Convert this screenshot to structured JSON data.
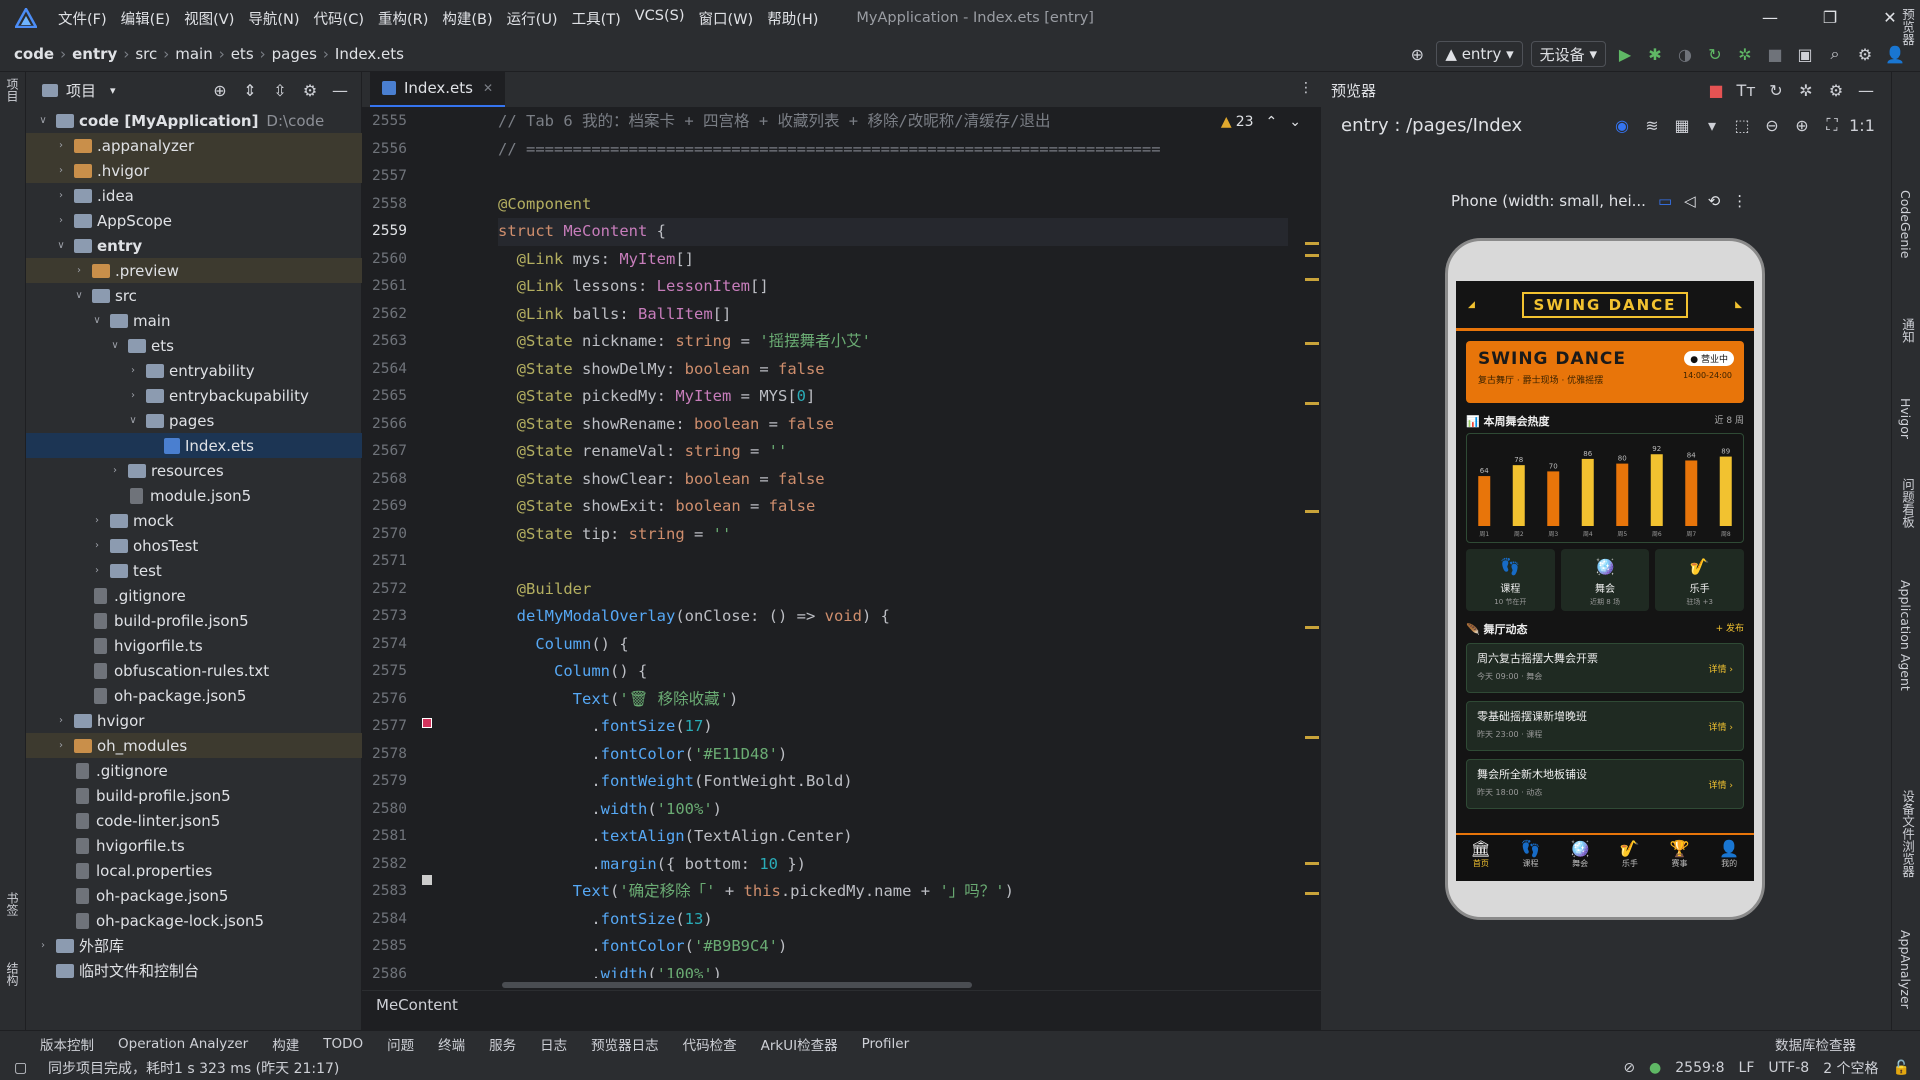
{
  "titlebar": {
    "menus": [
      "文件(F)",
      "编辑(E)",
      "视图(V)",
      "导航(N)",
      "代码(C)",
      "重构(R)",
      "构建(B)",
      "运行(U)",
      "工具(T)",
      "VCS(S)",
      "窗口(W)",
      "帮助(H)"
    ],
    "window_title": "MyApplication - Index.ets [entry]"
  },
  "toolbar": {
    "breadcrumbs": [
      "code",
      "entry",
      "src",
      "main",
      "ets",
      "pages",
      "Index.ets"
    ],
    "run_config": "entry",
    "device": "无设备"
  },
  "leftstrip": {
    "project_label": "项目",
    "bookmarks_label": "书签",
    "structure_label": "结构"
  },
  "project": {
    "title": "项目",
    "tree": [
      {
        "depth": 0,
        "chev": "v",
        "icon": "folder",
        "label": "code [MyApplication]",
        "path": "D:\\code",
        "bold": true
      },
      {
        "depth": 1,
        "chev": ">",
        "icon": "ofolder",
        "label": ".appanalyzer",
        "hl": true
      },
      {
        "depth": 1,
        "chev": ">",
        "icon": "ofolder",
        "label": ".hvigor",
        "hl": true
      },
      {
        "depth": 1,
        "chev": ">",
        "icon": "folder",
        "label": ".idea"
      },
      {
        "depth": 1,
        "chev": ">",
        "icon": "folder",
        "label": "AppScope"
      },
      {
        "depth": 1,
        "chev": "v",
        "icon": "folder",
        "label": "entry",
        "bold": true
      },
      {
        "depth": 2,
        "chev": ">",
        "icon": "ofolder",
        "label": ".preview",
        "hl": true
      },
      {
        "depth": 2,
        "chev": "v",
        "icon": "folder",
        "label": "src"
      },
      {
        "depth": 3,
        "chev": "v",
        "icon": "folder",
        "label": "main"
      },
      {
        "depth": 4,
        "chev": "v",
        "icon": "folder",
        "label": "ets"
      },
      {
        "depth": 5,
        "chev": ">",
        "icon": "folder",
        "label": "entryability"
      },
      {
        "depth": 5,
        "chev": ">",
        "icon": "folder",
        "label": "entrybackupability"
      },
      {
        "depth": 5,
        "chev": "v",
        "icon": "folder",
        "label": "pages"
      },
      {
        "depth": 6,
        "chev": "",
        "icon": "ets",
        "label": "Index.ets",
        "sel": true
      },
      {
        "depth": 4,
        "chev": ">",
        "icon": "folder",
        "label": "resources"
      },
      {
        "depth": 4,
        "chev": "",
        "icon": "file",
        "label": "module.json5"
      },
      {
        "depth": 3,
        "chev": ">",
        "icon": "folder",
        "label": "mock"
      },
      {
        "depth": 3,
        "chev": ">",
        "icon": "folder",
        "label": "ohosTest"
      },
      {
        "depth": 3,
        "chev": ">",
        "icon": "folder",
        "label": "test"
      },
      {
        "depth": 2,
        "chev": "",
        "icon": "file",
        "label": ".gitignore"
      },
      {
        "depth": 2,
        "chev": "",
        "icon": "file",
        "label": "build-profile.json5"
      },
      {
        "depth": 2,
        "chev": "",
        "icon": "file",
        "label": "hvigorfile.ts"
      },
      {
        "depth": 2,
        "chev": "",
        "icon": "file",
        "label": "obfuscation-rules.txt"
      },
      {
        "depth": 2,
        "chev": "",
        "icon": "file",
        "label": "oh-package.json5"
      },
      {
        "depth": 1,
        "chev": ">",
        "icon": "folder",
        "label": "hvigor"
      },
      {
        "depth": 1,
        "chev": ">",
        "icon": "ofolder",
        "label": "oh_modules",
        "hl": true
      },
      {
        "depth": 1,
        "chev": "",
        "icon": "file",
        "label": ".gitignore"
      },
      {
        "depth": 1,
        "chev": "",
        "icon": "file",
        "label": "build-profile.json5"
      },
      {
        "depth": 1,
        "chev": "",
        "icon": "file",
        "label": "code-linter.json5"
      },
      {
        "depth": 1,
        "chev": "",
        "icon": "file",
        "label": "hvigorfile.ts"
      },
      {
        "depth": 1,
        "chev": "",
        "icon": "file",
        "label": "local.properties"
      },
      {
        "depth": 1,
        "chev": "",
        "icon": "file",
        "label": "oh-package.json5"
      },
      {
        "depth": 1,
        "chev": "",
        "icon": "file",
        "label": "oh-package-lock.json5"
      },
      {
        "depth": 0,
        "chev": ">",
        "icon": "folder",
        "label": "外部库"
      },
      {
        "depth": 0,
        "chev": "",
        "icon": "folder",
        "label": "临时文件和控制台"
      }
    ]
  },
  "editor": {
    "tab": "Index.ets",
    "warning_count": "23",
    "current_line": "2559",
    "breadcrumb_footer": "MeContent",
    "lines": [
      {
        "n": "2555",
        "html": "<span class=\"cmt\">// Tab 6 我的：档案卡 + 四宫格 + 收藏列表 + 移除/改昵称/清缓存/退出</span>"
      },
      {
        "n": "2556",
        "html": "<span class=\"cmt\">// ====================================================================</span>"
      },
      {
        "n": "2557",
        "html": ""
      },
      {
        "n": "2558",
        "html": "<span class=\"ann\">@Component</span>"
      },
      {
        "n": "2559",
        "html": "<span class=\"kw\">struct</span> <span class=\"typ\">MeContent</span> {"
      },
      {
        "n": "2560",
        "html": "  <span class=\"ann\">@Link</span> mys: <span class=\"typ\">MyItem</span>[]"
      },
      {
        "n": "2561",
        "html": "  <span class=\"ann\">@Link</span> lessons: <span class=\"typ\">LessonItem</span>[]"
      },
      {
        "n": "2562",
        "html": "  <span class=\"ann\">@Link</span> balls: <span class=\"typ\">BallItem</span>[]"
      },
      {
        "n": "2563",
        "html": "  <span class=\"ann\">@State</span> nickname: <span class=\"kw\">string</span> = <span class=\"str\">'摇摆舞者小艾'</span>"
      },
      {
        "n": "2564",
        "html": "  <span class=\"ann\">@State</span> showDelMy: <span class=\"kw\">boolean</span> = <span class=\"kw\">false</span>"
      },
      {
        "n": "2565",
        "html": "  <span class=\"ann\">@State</span> pickedMy: <span class=\"typ\">MyItem</span> = MYS[<span class=\"num\">0</span>]"
      },
      {
        "n": "2566",
        "html": "  <span class=\"ann\">@State</span> showRename: <span class=\"kw\">boolean</span> = <span class=\"kw\">false</span>"
      },
      {
        "n": "2567",
        "html": "  <span class=\"ann\">@State</span> renameVal: <span class=\"kw\">string</span> = <span class=\"str\">''</span>"
      },
      {
        "n": "2568",
        "html": "  <span class=\"ann\">@State</span> showClear: <span class=\"kw\">boolean</span> = <span class=\"kw\">false</span>"
      },
      {
        "n": "2569",
        "html": "  <span class=\"ann\">@State</span> showExit: <span class=\"kw\">boolean</span> = <span class=\"kw\">false</span>"
      },
      {
        "n": "2570",
        "html": "  <span class=\"ann\">@State</span> tip: <span class=\"kw\">string</span> = <span class=\"str\">''</span>"
      },
      {
        "n": "2571",
        "html": ""
      },
      {
        "n": "2572",
        "html": "  <span class=\"ann\">@Builder</span>"
      },
      {
        "n": "2573",
        "html": "  <span class=\"fn\">delMyModalOverlay</span>(onClose: () => <span class=\"kw\">void</span>) {"
      },
      {
        "n": "2574",
        "html": "    <span class=\"fn\">Column</span>() {"
      },
      {
        "n": "2575",
        "html": "      <span class=\"fn\">Column</span>() {"
      },
      {
        "n": "2576",
        "html": "        <span class=\"fn\">Text</span>(<span class=\"str\">'🗑 移除收藏'</span>)"
      },
      {
        "n": "2577",
        "html": "          .<span class=\"fn\">fontSize</span>(<span class=\"num\">17</span>)"
      },
      {
        "n": "2578",
        "html": "          .<span class=\"fn\">fontColor</span>(<span class=\"str\">'#E11D48'</span>)"
      },
      {
        "n": "2579",
        "html": "          .<span class=\"fn\">fontWeight</span>(FontWeight.Bold)"
      },
      {
        "n": "2580",
        "html": "          .<span class=\"fn\">width</span>(<span class=\"str\">'100%'</span>)"
      },
      {
        "n": "2581",
        "html": "          .<span class=\"fn\">textAlign</span>(TextAlign.Center)"
      },
      {
        "n": "2582",
        "html": "          .<span class=\"fn\">margin</span>({ bottom: <span class=\"num\">10</span> })"
      },
      {
        "n": "2583",
        "html": "        <span class=\"fn\">Text</span>(<span class=\"str\">'确定移除「'</span> + <span class=\"kw\">this</span>.pickedMy.name + <span class=\"str\">'」吗？'</span>)"
      },
      {
        "n": "2584",
        "html": "          .<span class=\"fn\">fontSize</span>(<span class=\"num\">13</span>)"
      },
      {
        "n": "2585",
        "html": "          .<span class=\"fn\">fontColor</span>(<span class=\"str\">'#B9B9C4'</span>)"
      },
      {
        "n": "2586",
        "html": "          .<span class=\"fn\">width</span>(<span class=\"str\">'100%'</span>)"
      }
    ]
  },
  "preview": {
    "title": "预览器",
    "route": "entry : /pages/Index",
    "device_label": "Phone (width: small, hei..."
  },
  "phone": {
    "logo": "SWING DANCE",
    "card_title": "SWING DANCE",
    "card_sub": "复古舞厅 · 爵士现场 · 优雅摇摆",
    "card_badge": "营业中",
    "card_time": "14:00-24:00",
    "heat_title": "本周舞会热度",
    "heat_range": "近 8 周",
    "heat_values": [
      64,
      78,
      70,
      86,
      80,
      92,
      84,
      89
    ],
    "heat_colors": [
      "#e8750a",
      "#f2c230"
    ],
    "heat_labels": [
      "周1",
      "周2",
      "周3",
      "周4",
      "周5",
      "周6",
      "周7",
      "周8"
    ],
    "grid": [
      {
        "icon": "👣",
        "name": "课程",
        "desc": "10 节在开"
      },
      {
        "icon": "🪩",
        "name": "舞会",
        "desc": "近期 8 场"
      },
      {
        "icon": "🎷",
        "name": "乐手",
        "desc": "驻场 +3"
      }
    ],
    "news_title": "舞厅动态",
    "news_action": "+ 发布",
    "news": [
      {
        "title": "周六复古摇摆大舞会开票",
        "meta": "今天 09:00 · 舞会",
        "detail": "详情 ›"
      },
      {
        "title": "零基础摇摆课新增晚班",
        "meta": "昨天 23:00 · 课程",
        "detail": "详情 ›"
      },
      {
        "title": "舞会所全新木地板铺设",
        "meta": "昨天 18:00 · 动态",
        "detail": "详情 ›"
      }
    ],
    "nav": [
      {
        "icon": "🏛",
        "label": "首页",
        "active": true
      },
      {
        "icon": "👣",
        "label": "课程"
      },
      {
        "icon": "🪩",
        "label": "舞会"
      },
      {
        "icon": "🎷",
        "label": "乐手"
      },
      {
        "icon": "🏆",
        "label": "赛事"
      },
      {
        "icon": "👤",
        "label": "我的"
      }
    ]
  },
  "rightstrip": {
    "labels": [
      "预览器",
      "CodeGenie",
      "通知",
      "Hvigor",
      "问题看板",
      "Application Agent",
      "设备文件浏览器",
      "AppAnalyzer"
    ]
  },
  "bottombar": {
    "items": [
      "版本控制",
      "Operation Analyzer",
      "构建",
      "TODO",
      "问题",
      "终端",
      "服务",
      "日志",
      "预览器日志",
      "代码检查",
      "ArkUI检查器",
      "Profiler"
    ],
    "right": "数据库检查器"
  },
  "status": {
    "message": "同步项目完成，耗时1 s 323 ms (昨天 21:17)",
    "position": "2559:8",
    "line_ending": "LF",
    "encoding": "UTF-8",
    "indent": "2 个空格"
  }
}
